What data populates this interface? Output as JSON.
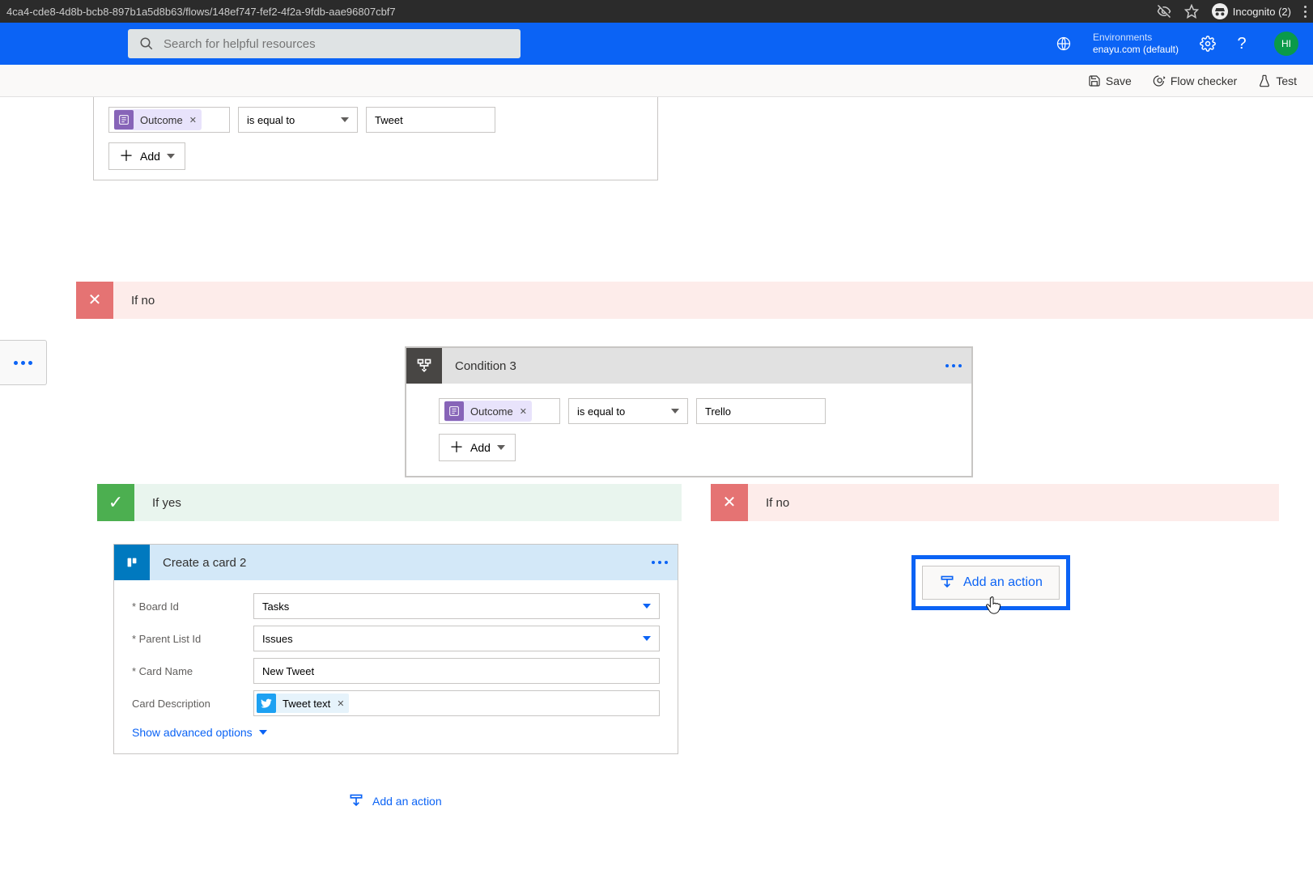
{
  "browser": {
    "url": "4ca4-cde8-4d8b-bcb8-897b1a5d8b63/flows/148ef747-fef2-4f2a-9fdb-aae96807cbf7",
    "incognito_label": "Incognito (2)"
  },
  "header": {
    "search_placeholder": "Search for helpful resources",
    "env_label": "Environments",
    "env_value": "enayu.com (default)",
    "avatar_initials": "HI"
  },
  "commands": {
    "save": "Save",
    "flow_checker": "Flow checker",
    "test": "Test"
  },
  "condition_top": {
    "token_label": "Outcome",
    "operator": "is equal to",
    "value": "Tweet",
    "add_label": "Add"
  },
  "ifno_top_label": "If no",
  "condition3": {
    "title": "Condition 3",
    "token_label": "Outcome",
    "operator": "is equal to",
    "value": "Trello",
    "add_label": "Add"
  },
  "branch": {
    "yes_label": "If yes",
    "no_label": "If no"
  },
  "trello": {
    "title": "Create a card 2",
    "fields": {
      "board_label": "* Board Id",
      "board_value": "Tasks",
      "list_label": "* Parent List Id",
      "list_value": "Issues",
      "name_label": "* Card Name",
      "name_value": "New Tweet",
      "desc_label": "Card Description",
      "desc_token": "Tweet text"
    },
    "advanced_label": "Show advanced options"
  },
  "add_action_label": "Add an action"
}
